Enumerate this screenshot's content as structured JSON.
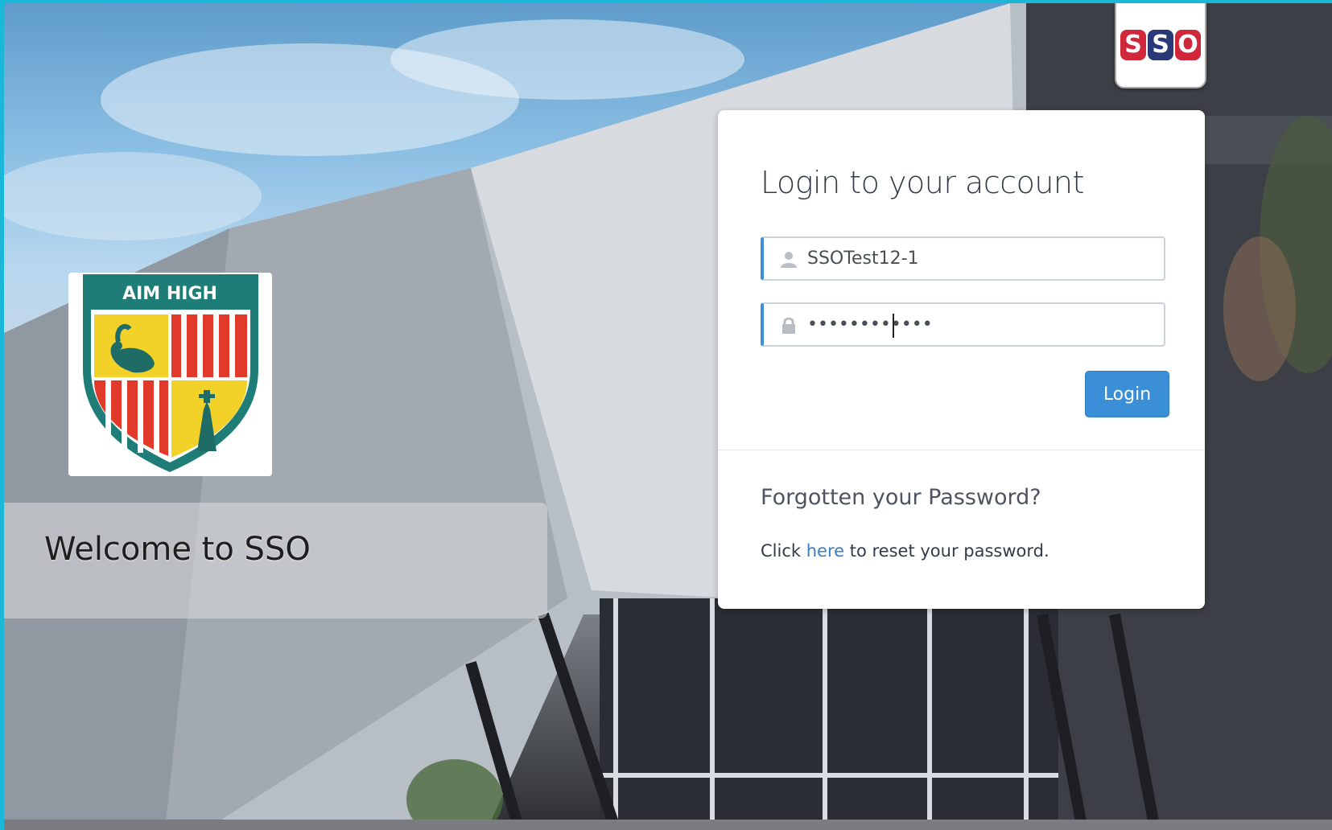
{
  "brand": {
    "badge_letters": [
      "S",
      "S",
      "O"
    ],
    "badge_colors": [
      "#d0283a",
      "#2a3a78",
      "#d0283a"
    ]
  },
  "school": {
    "motto": "AIM HIGH",
    "welcome": "Welcome to SSO"
  },
  "login": {
    "title": "Login to your account",
    "username_value": "SSOTest12-1",
    "password_masked": "••••••••••••",
    "login_label": "Login",
    "forgot_title": "Forgotten your Password?",
    "reset_prefix": "Click",
    "reset_link": "here",
    "reset_suffix": "to reset your password."
  },
  "colors": {
    "accent": "#3a8fd6",
    "link": "#3a7fc4",
    "frame": "#1bb7d8"
  },
  "icons": {
    "username": "user-icon",
    "password": "lock-icon"
  }
}
